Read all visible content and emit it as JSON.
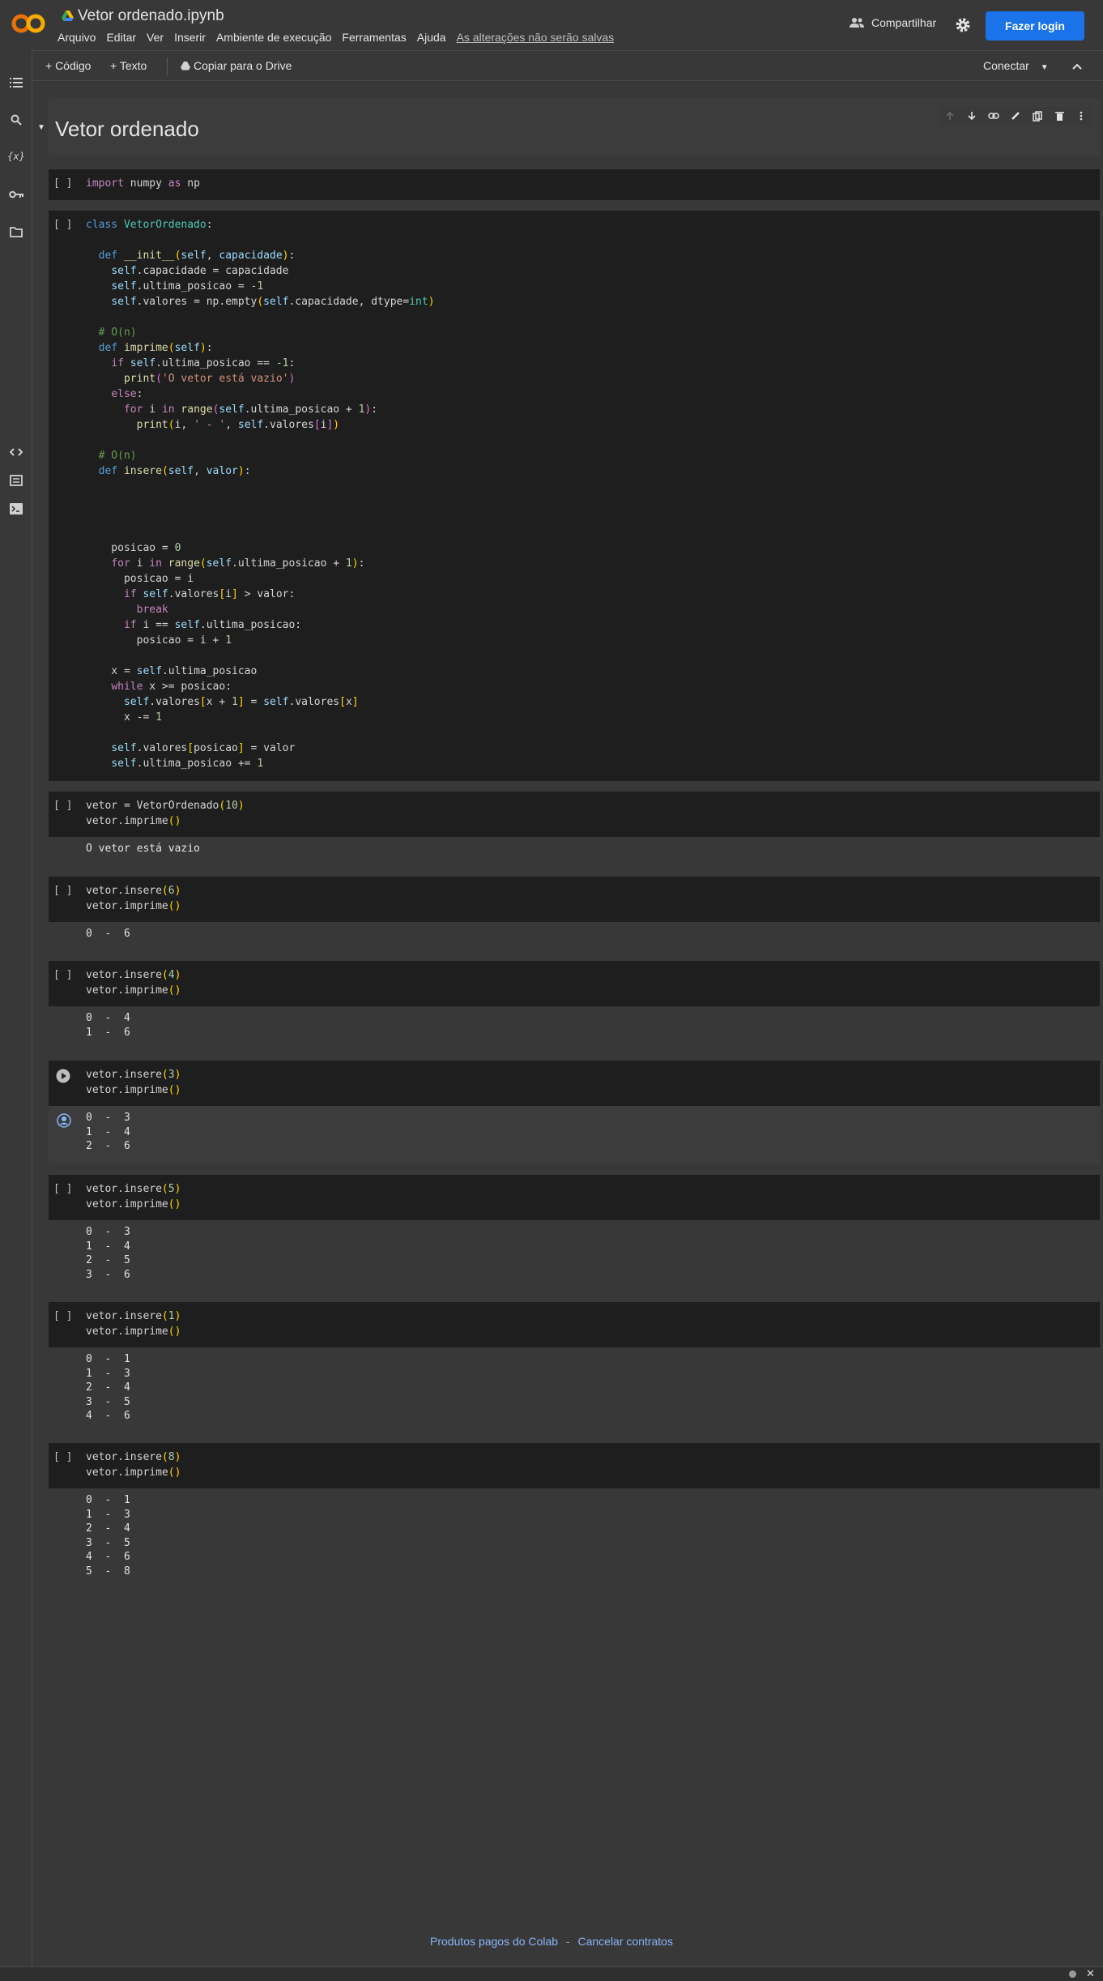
{
  "header": {
    "doc_title": "Vetor ordenado.ipynb",
    "menu": [
      "Arquivo",
      "Editar",
      "Ver",
      "Inserir",
      "Ambiente de execução",
      "Ferramentas",
      "Ajuda"
    ],
    "unsaved_notice": "As alterações não serão salvas",
    "share_label": "Compartilhar",
    "login_label": "Fazer login"
  },
  "toolbar": {
    "add_code": "+ Código",
    "add_text": "+ Texto",
    "copy_drive": "Copiar para o Drive",
    "connect": "Conectar"
  },
  "section": {
    "title": "Vetor ordenado"
  },
  "cells": [
    {
      "code": "import numpy as np",
      "output": ""
    },
    {
      "code": "class VetorOrdenado:",
      "output": ""
    },
    {
      "code": "vetor = VetorOrdenado(10)\nvetor.imprime()",
      "output": "O vetor está vazio"
    },
    {
      "code": "vetor.insere(6)\nvetor.imprime()",
      "output": "0  -  6"
    },
    {
      "code": "vetor.insere(4)\nvetor.imprime()",
      "output": "0  -  4\n1  -  6"
    },
    {
      "code": "vetor.insere(3)\nvetor.imprime()",
      "output": "0  -  3\n1  -  4\n2  -  6"
    },
    {
      "code": "vetor.insere(5)\nvetor.imprime()",
      "output": "0  -  3\n1  -  4\n2  -  5\n3  -  6"
    },
    {
      "code": "vetor.insere(1)\nvetor.imprime()",
      "output": "0  -  1\n1  -  3\n2  -  4\n3  -  5\n4  -  6"
    },
    {
      "code": "vetor.insere(8)\nvetor.imprime()",
      "output": "0  -  1\n1  -  3\n2  -  4\n3  -  5\n4  -  6\n5  -  8"
    }
  ],
  "footer": {
    "paid_products": "Produtos pagos do Colab",
    "separator": "-",
    "cancel_contracts": "Cancelar contratos"
  },
  "colors": {
    "accent": "#1a73e8",
    "background": "#383838",
    "code_bg": "#1e1e1e",
    "logo_orange": "#f9ab00",
    "logo_dark_orange": "#e8710a"
  }
}
